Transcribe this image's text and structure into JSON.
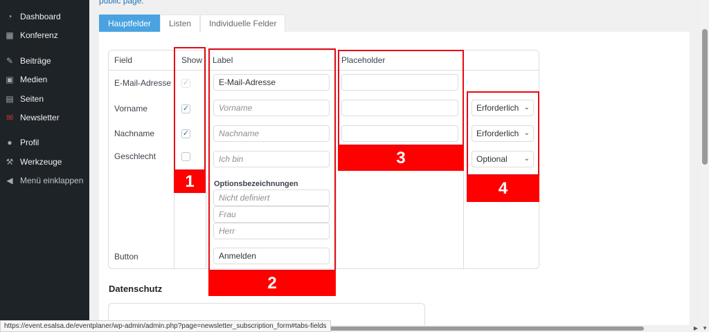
{
  "sidebar": {
    "items": [
      {
        "label": "Dashboard",
        "icon": "dashboard-icon"
      },
      {
        "label": "Konferenz",
        "icon": "calendar-icon"
      },
      {
        "label": "Beiträge",
        "icon": "pin-icon"
      },
      {
        "label": "Medien",
        "icon": "media-icon"
      },
      {
        "label": "Seiten",
        "icon": "pages-icon"
      },
      {
        "label": "Newsletter",
        "icon": "newsletter-icon"
      },
      {
        "label": "Profil",
        "icon": "user-icon"
      },
      {
        "label": "Werkzeuge",
        "icon": "wrench-icon"
      },
      {
        "label": "Menü einklappen",
        "icon": "collapse-icon"
      }
    ]
  },
  "top_text": "public page.",
  "tabs": [
    {
      "label": "Hauptfelder",
      "active": true
    },
    {
      "label": "Listen",
      "active": false
    },
    {
      "label": "Individuelle Felder",
      "active": false
    }
  ],
  "table": {
    "headers": {
      "field": "Field",
      "show": "Show",
      "label": "Label",
      "placeholder": "Placeholder"
    },
    "rows": {
      "email": {
        "field": "E-Mail-Adresse",
        "label": "E-Mail-Adresse"
      },
      "vorname": {
        "field": "Vorname",
        "label_placeholder": "Vorname",
        "select": "Erforderlich"
      },
      "nachname": {
        "field": "Nachname",
        "label_placeholder": "Nachname",
        "select": "Erforderlich"
      },
      "geschlecht": {
        "field": "Geschlecht",
        "label_placeholder": "Ich bin",
        "select": "Optional",
        "options_title": "Optionsbezeichnungen",
        "options": [
          "Nicht definiert",
          "Frau",
          "Herr"
        ]
      },
      "button": {
        "field": "Button",
        "label": "Anmelden"
      }
    }
  },
  "section": {
    "datenschutz": "Datenschutz"
  },
  "annotations": [
    "1",
    "2",
    "3",
    "4"
  ],
  "status_url": "https://event.esalsa.de/eventplaner/wp-admin/admin.php?page=newsletter_subscription_form#tabs-fields",
  "colors": {
    "sidebar_bg": "#1d2327",
    "tab_active": "#4aa3e0",
    "annotation_red": "#ff0000",
    "checkbox_blue": "#2271b1"
  }
}
